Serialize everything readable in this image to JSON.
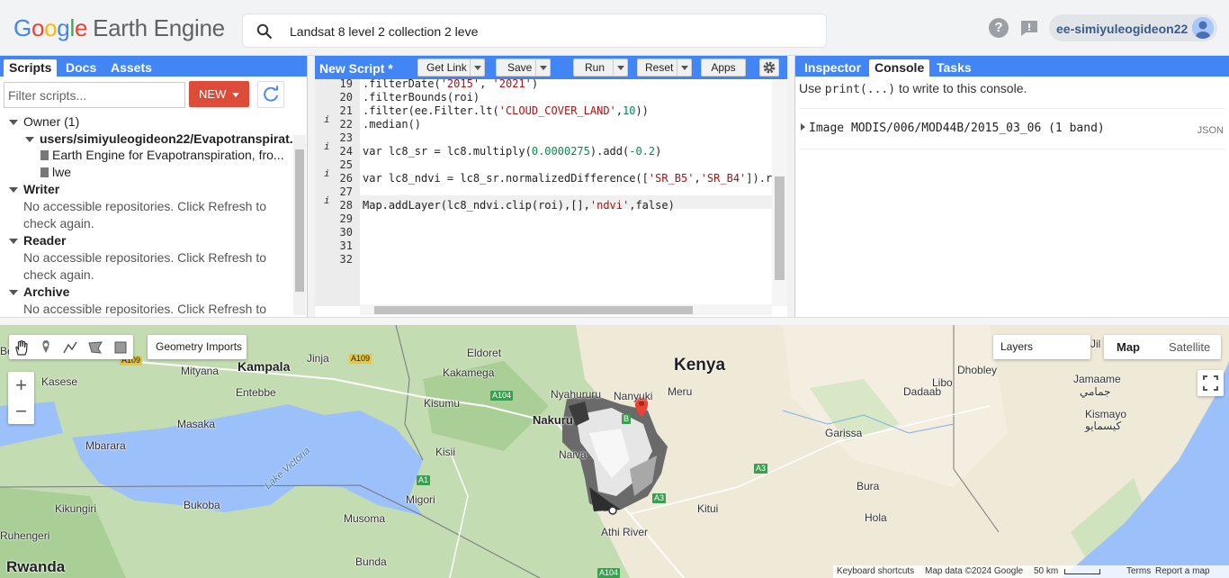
{
  "header": {
    "logo_google": [
      "G",
      "o",
      "o",
      "g",
      "l",
      "e"
    ],
    "logo_product": "Earth Engine",
    "search_text": "Landsat 8 level 2 collection 2 leve",
    "account_name": "ee-simiyuleogideon22",
    "help_glyph": "?"
  },
  "left_panel": {
    "tabs": [
      "Scripts",
      "Docs",
      "Assets"
    ],
    "filter_placeholder": "Filter scripts...",
    "new_label": "NEW",
    "tree": {
      "owner": "Owner (1)",
      "repo": "users/simiyuleogideon22/Evapotranspirat...",
      "file1": "Earth Engine for Evapotranspiration, fro...",
      "file2": "lwe",
      "writer": "Writer",
      "writer_msg1": "No accessible repositories. Click Refresh to",
      "writer_msg2": "check again.",
      "reader": "Reader",
      "reader_msg1": "No accessible repositories. Click Refresh to",
      "reader_msg2": "check again.",
      "archive": "Archive",
      "archive_msg1": "No accessible repositories. Click Refresh to"
    }
  },
  "editor": {
    "title": "New Script *",
    "buttons": {
      "get_link": "Get Link",
      "save": "Save",
      "run": "Run",
      "reset": "Reset",
      "apps": "Apps"
    },
    "line_numbers": [
      "19",
      "20",
      "21",
      "22",
      "23",
      "24",
      "25",
      "26",
      "27",
      "28",
      "29",
      "30",
      "31",
      "32"
    ],
    "lines": [
      ".filterDate('2015', '2021')",
      ".filterBounds(roi)",
      ".filter(ee.Filter.lt('CLOUD_COVER_LAND',10))",
      ".median()",
      "",
      "var lc8_sr = lc8.multiply(0.0000275).add(-0.2)",
      "",
      "var lc8_ndvi = lc8_sr.normalizedDifference(['SR_B5','SR_B4']).re",
      "",
      "Map.addLayer(lc8_ndvi.clip(roi),[],'ndvi',false)",
      "",
      "",
      "",
      ""
    ],
    "info_lines": [
      "22",
      "24",
      "26",
      "28"
    ]
  },
  "right_panel": {
    "tabs": [
      "Inspector",
      "Console",
      "Tasks"
    ],
    "hint_pre": "Use ",
    "hint_code": "print(...)",
    "hint_post": " to write to this console.",
    "entry": "Image MODIS/006/MOD44B/2015_03_06 (1 band)",
    "entry_tag": "JSON"
  },
  "map": {
    "geometry_imports": "Geometry Imports",
    "layers": "Layers",
    "map_type": [
      "Map",
      "Satellite"
    ],
    "zoom_in": "+",
    "zoom_out": "−",
    "labels": {
      "kenya": "Kenya",
      "kampala": "Kampala",
      "mityana": "Mityana",
      "jinja": "Jinja",
      "kasese": "Kasese",
      "entebbe": "Entebbe",
      "masaka": "Masaka",
      "mbarara": "Mbarara",
      "bukoba": "Bukoba",
      "kikungiri": "Kikungiri",
      "ruhengeri": "Ruhengeri",
      "rwanda": "Rwanda",
      "musoma": "Musoma",
      "bunda": "Bunda",
      "eldoret": "Eldoret",
      "kakamega": "Kakamega",
      "kisumu": "Kisumu",
      "kisii": "Kisii",
      "migori": "Migori",
      "nyahururu": "Nyahururu",
      "nanyuki": "Nanyuki",
      "meru": "Meru",
      "nakuru": "Nakuru",
      "naivasha": "Naiva",
      "kitui": "Kitui",
      "athi_river": "Athi River",
      "garissa": "Garissa",
      "bura": "Bura",
      "hola": "Hola",
      "dadaab": "Dadaab",
      "dhobley": "Dhobley",
      "jilib": "Jil",
      "jamaame": "Jamaame",
      "jamaame_ar": "جمامي",
      "kismayo": "Kismayo",
      "kismayo_ar": "كيسمايو",
      "libo": "Libo",
      "lake_victoria": "Lake Victoria",
      "be": "Be"
    },
    "roads": [
      "A109",
      "A109",
      "A104",
      "A1",
      "A3",
      "A3",
      "A104",
      "B"
    ],
    "attribution": {
      "shortcuts": "Keyboard shortcuts",
      "data": "Map data ©2024 Google",
      "scale": "50 km",
      "terms": "Terms",
      "report": "Report a map error"
    }
  }
}
